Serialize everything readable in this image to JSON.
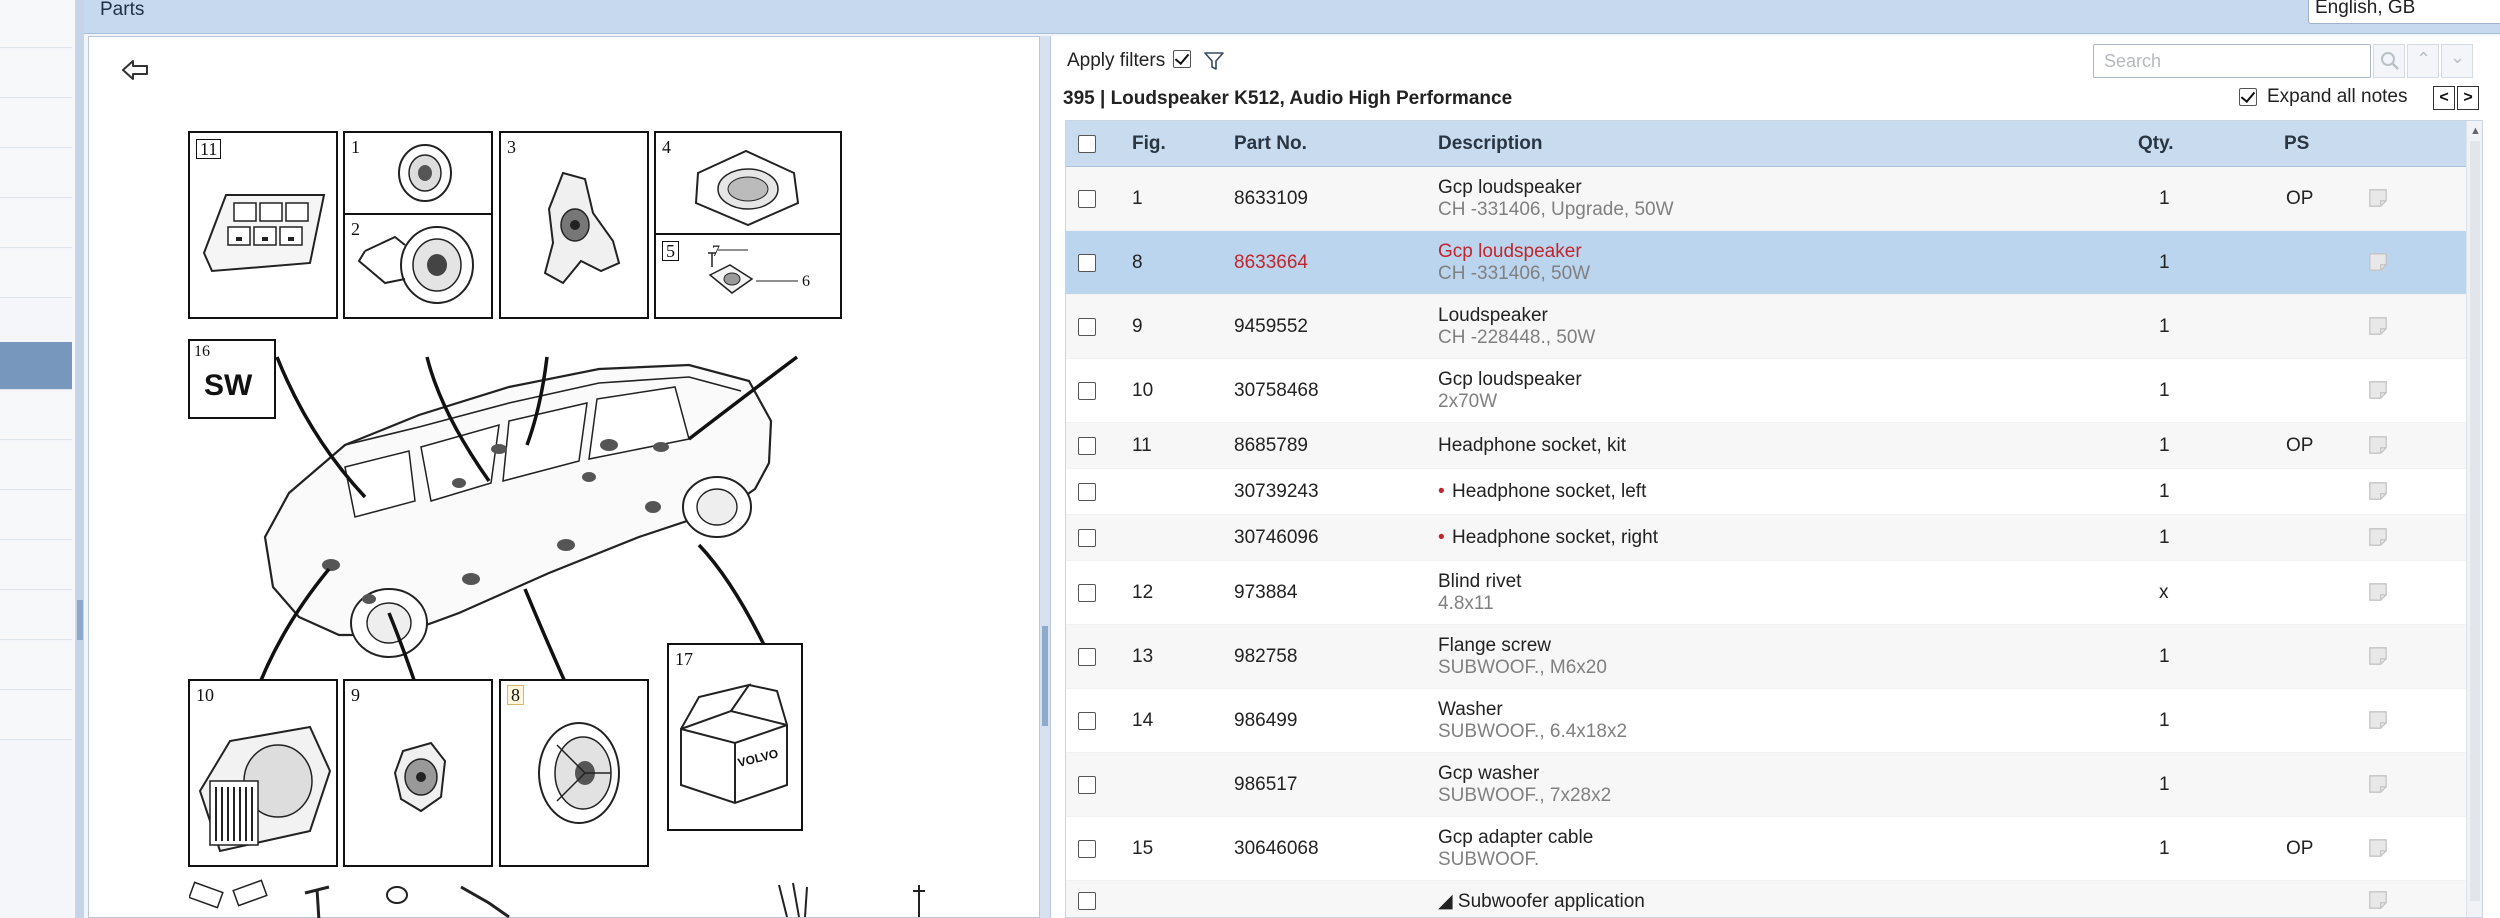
{
  "topbar": {
    "title": "Parts",
    "language": "English, GB"
  },
  "figure": {
    "callouts": {
      "n11": "11",
      "n1": "1",
      "n2": "2",
      "n3": "3",
      "n4": "4",
      "n5": "5",
      "n6": "6",
      "n7": "7",
      "n16": "16",
      "sw": "SW",
      "n10": "10",
      "n9": "9",
      "n8": "8",
      "n17": "17",
      "box_brand": "VOLVO"
    }
  },
  "filters": {
    "apply_label": "Apply filters",
    "apply_checked": true,
    "search_placeholder": "Search",
    "expand_notes_label": "Expand all notes",
    "expand_checked": true,
    "prev_note": "<",
    "next_note": ">"
  },
  "section": {
    "title": "395  |  Loudspeaker K512, Audio High Performance"
  },
  "table": {
    "headers": {
      "fig": "Fig.",
      "part_no": "Part No.",
      "description": "Description",
      "qty": "Qty.",
      "ps": "PS"
    },
    "rows": [
      {
        "fig": "1",
        "part_no": "8633109",
        "desc": "Gcp loudspeaker",
        "sub": "CH -331406, Upgrade, 50W",
        "qty": "1",
        "ps": "OP"
      },
      {
        "fig": "8",
        "part_no": "8633664",
        "desc": "Gcp loudspeaker",
        "sub": "CH -331406, 50W",
        "qty": "1",
        "ps": "",
        "selected": true
      },
      {
        "fig": "9",
        "part_no": "9459552",
        "desc": "Loudspeaker",
        "sub": "CH -228448., 50W",
        "qty": "1",
        "ps": ""
      },
      {
        "fig": "10",
        "part_no": "30758468",
        "desc": "Gcp loudspeaker",
        "sub": "2x70W",
        "qty": "1",
        "ps": ""
      },
      {
        "fig": "11",
        "part_no": "8685789",
        "desc": "Headphone socket, kit",
        "sub": "",
        "qty": "1",
        "ps": "OP"
      },
      {
        "fig": "",
        "part_no": "30739243",
        "desc": "Headphone socket, left",
        "sub": "",
        "qty": "1",
        "ps": "",
        "bullet": "•"
      },
      {
        "fig": "",
        "part_no": "30746096",
        "desc": "Headphone socket, right",
        "sub": "",
        "qty": "1",
        "ps": "",
        "bullet": "•"
      },
      {
        "fig": "12",
        "part_no": "973884",
        "desc": "Blind rivet",
        "sub": "4.8x11",
        "qty": "x",
        "ps": ""
      },
      {
        "fig": "13",
        "part_no": "982758",
        "desc": "Flange screw",
        "sub": "SUBWOOF., M6x20",
        "qty": "1",
        "ps": ""
      },
      {
        "fig": "14",
        "part_no": "986499",
        "desc": "Washer",
        "sub": "SUBWOOF., 6.4x18x2",
        "qty": "1",
        "ps": ""
      },
      {
        "fig": "",
        "part_no": "986517",
        "desc": "Gcp washer",
        "sub": "SUBWOOF., 7x28x2",
        "qty": "1",
        "ps": ""
      },
      {
        "fig": "15",
        "part_no": "30646068",
        "desc": "Gcp adapter cable",
        "sub": "SUBWOOF.",
        "qty": "1",
        "ps": "OP"
      },
      {
        "fig": "",
        "part_no": "",
        "desc": "◢ Subwoofer application",
        "sub": "",
        "qty": "",
        "ps": ""
      }
    ]
  },
  "icons": {
    "back": "back-arrow-icon",
    "filter": "funnel-icon",
    "search": "magnifier-icon",
    "print": "printer-icon",
    "note": "note-icon"
  },
  "colors": {
    "header_bg": "#c9dbee",
    "selected_row": "#bcd5ef",
    "selected_text": "#c0262b",
    "rail_active": "#7797bd"
  }
}
